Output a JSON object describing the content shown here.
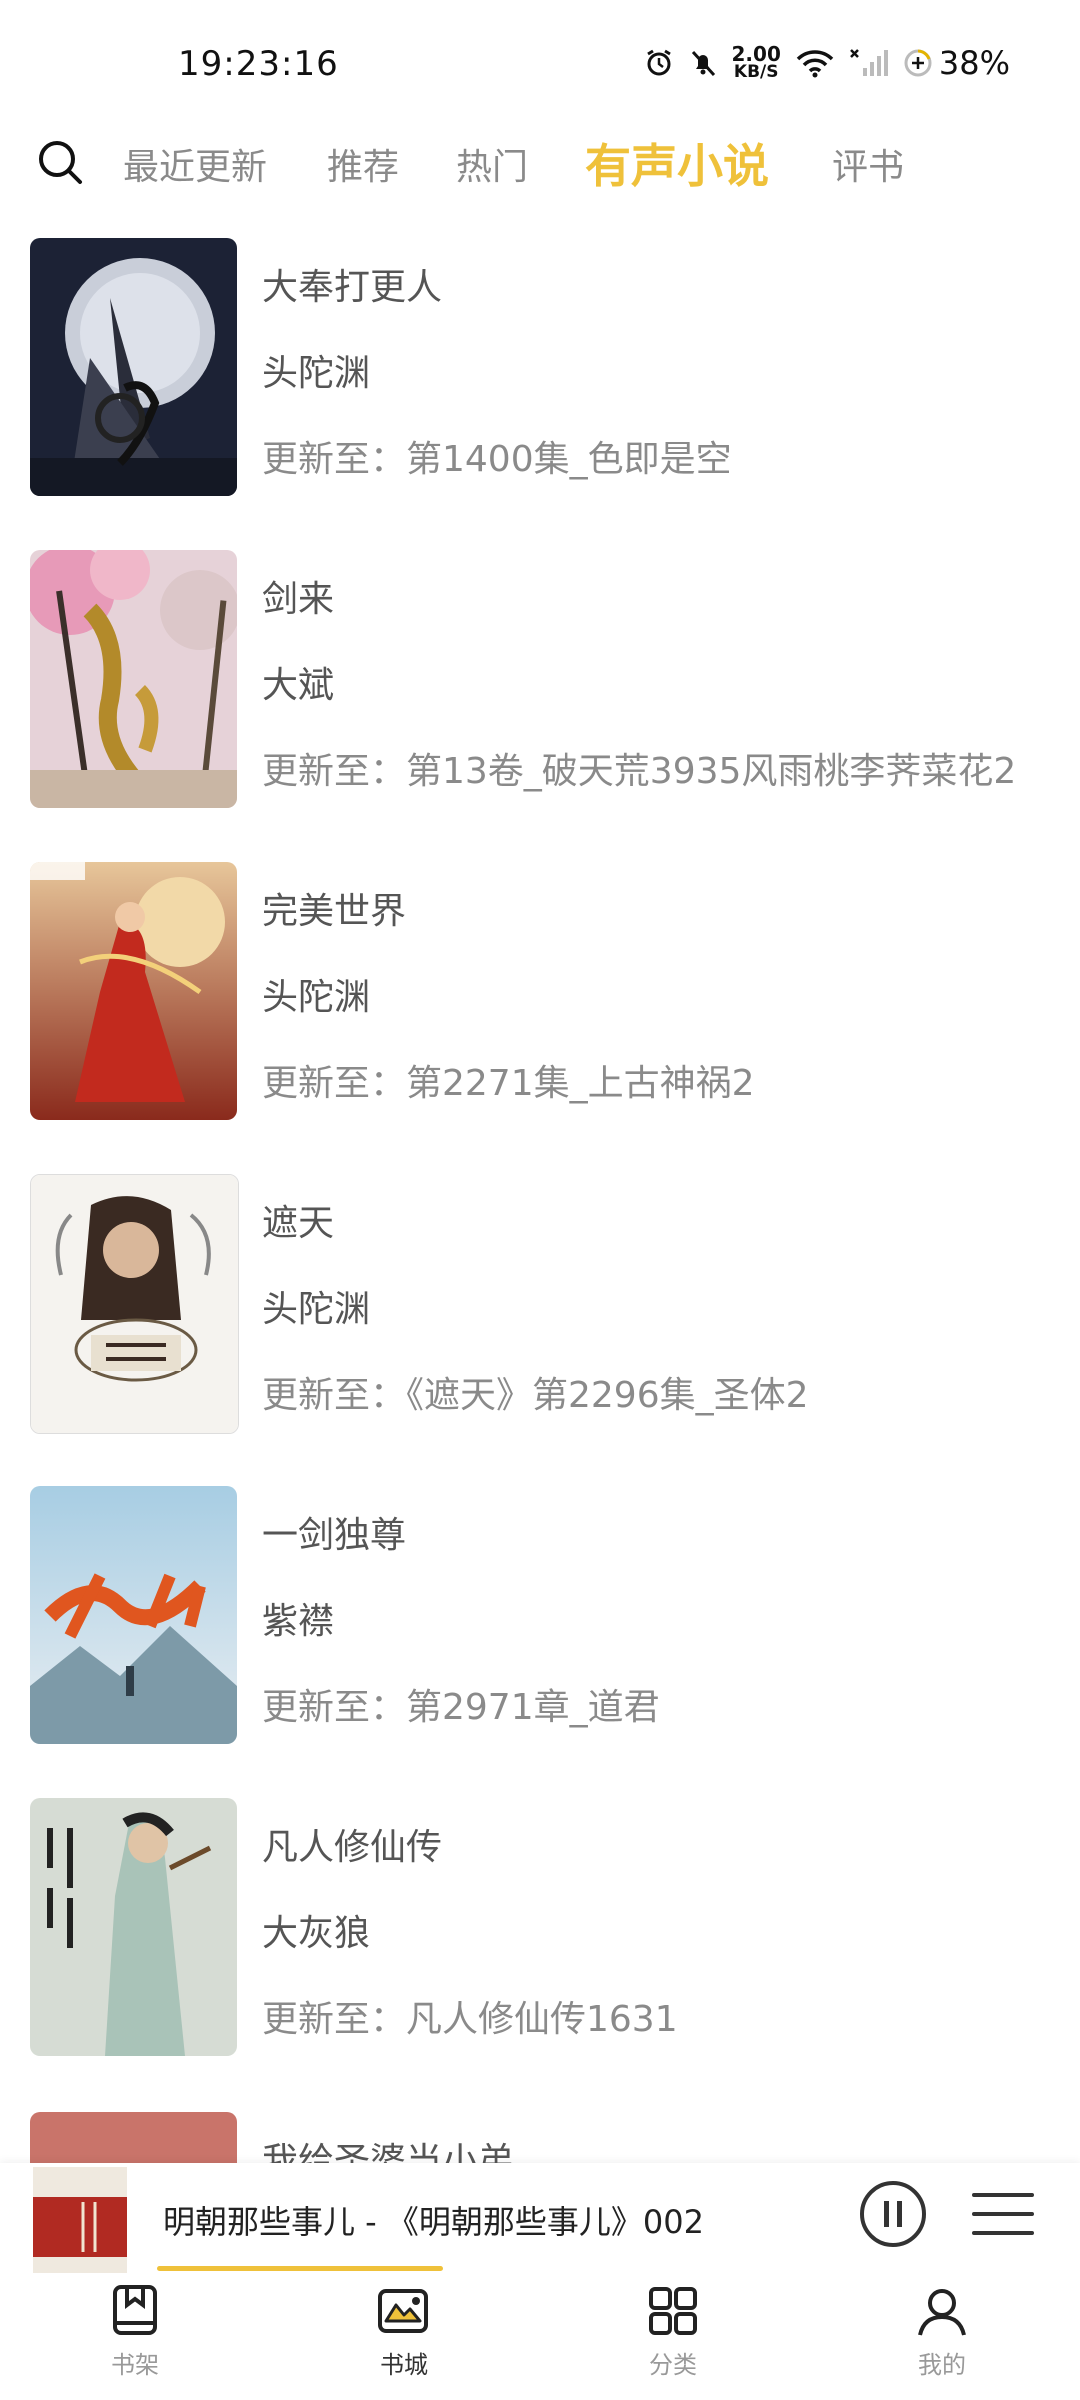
{
  "status_bar": {
    "time": "19:23:16",
    "net_speed_value": "2.00",
    "net_speed_unit": "KB/S",
    "battery": "38%",
    "icons": [
      "alarm-icon",
      "mute-icon",
      "wifi-icon",
      "no-signal-icon",
      "battery-icon"
    ]
  },
  "tabs": [
    {
      "label": "最近更新"
    },
    {
      "label": "推荐"
    },
    {
      "label": "热门"
    },
    {
      "label": "有声小说",
      "active": true
    },
    {
      "label": "评书"
    }
  ],
  "books": [
    {
      "title": "大奉打更人",
      "author": "头陀渊",
      "update": "更新至：第1400集_色即是空"
    },
    {
      "title": "剑来",
      "author": "大斌",
      "update": "更新至：第13卷_破天荒3935风雨桃李荠菜花2"
    },
    {
      "title": "完美世界",
      "author": "头陀渊",
      "update": "更新至：第2271集_上古神祸2"
    },
    {
      "title": "遮天",
      "author": "头陀渊",
      "update": "更新至：《遮天》第2296集_圣体2"
    },
    {
      "title": "一剑独尊",
      "author": "紫襟",
      "update": "更新至：第2971章_道君"
    },
    {
      "title": "凡人修仙传",
      "author": "大灰狼",
      "update": "更新至：凡人修仙传1631"
    }
  ],
  "partial_book": {
    "title": "我给圣婆当小弟"
  },
  "player": {
    "title": "明朝那些事儿 - 《明朝那些事儿》002",
    "progress": 0.3
  },
  "nav": [
    {
      "label": "书架",
      "icon": "bookshelf-icon"
    },
    {
      "label": "书城",
      "icon": "bookstore-icon",
      "active": true
    },
    {
      "label": "分类",
      "icon": "category-icon"
    },
    {
      "label": "我的",
      "icon": "profile-icon"
    }
  ]
}
